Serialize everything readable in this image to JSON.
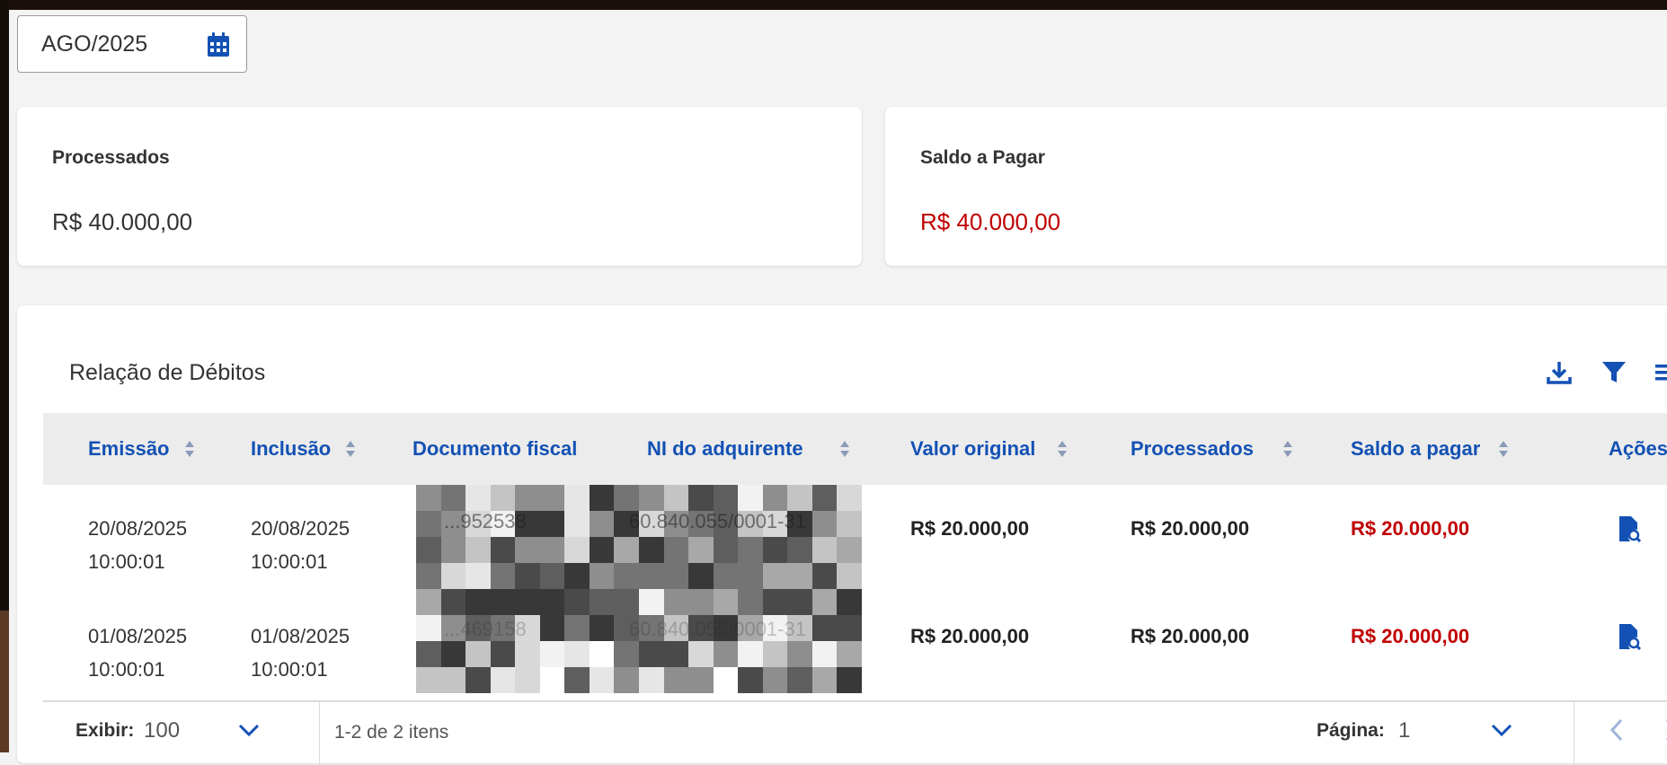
{
  "month_selector": {
    "value": "AGO/2025",
    "icon": "calendar-icon"
  },
  "summary": {
    "processados": {
      "label": "Processados",
      "value": "R$ 40.000,00"
    },
    "saldo": {
      "label": "Saldo a Pagar",
      "value": "R$ 40.000,00",
      "color": "#c00000"
    }
  },
  "panel": {
    "title": "Relação de Débitos",
    "toolbar_icons": [
      "download-icon",
      "filter-icon",
      "more-icon"
    ]
  },
  "table": {
    "columns": [
      "Emissão",
      "Inclusão",
      "Documento fiscal",
      "NI do adquirente",
      "Valor original",
      "Processados",
      "Saldo a pagar",
      "Ações"
    ],
    "rows": [
      {
        "emissao_date": "20/08/2025",
        "emissao_time": "10:00:01",
        "inclusao_date": "20/08/2025",
        "inclusao_time": "10:00:01",
        "documento": "...952538",
        "ni": "60.840.055/0001-31",
        "valor_original": "R$ 20.000,00",
        "processados": "R$ 20.000,00",
        "saldo": "R$ 20.000,00"
      },
      {
        "emissao_date": "01/08/2025",
        "emissao_time": "10:00:01",
        "inclusao_date": "01/08/2025",
        "inclusao_time": "10:00:01",
        "documento": "...469158",
        "ni": "60.840.055/0001-31",
        "valor_original": "R$ 20.000,00",
        "processados": "R$ 20.000,00",
        "saldo": "R$ 20.000,00"
      }
    ]
  },
  "footer": {
    "exibir_label": "Exibir:",
    "exibir_value": "100",
    "range_text": "1-2 de 2 itens",
    "pagina_label": "Página:",
    "pagina_value": "1"
  },
  "colors": {
    "primary": "#1351b4",
    "negative": "#c00000"
  }
}
